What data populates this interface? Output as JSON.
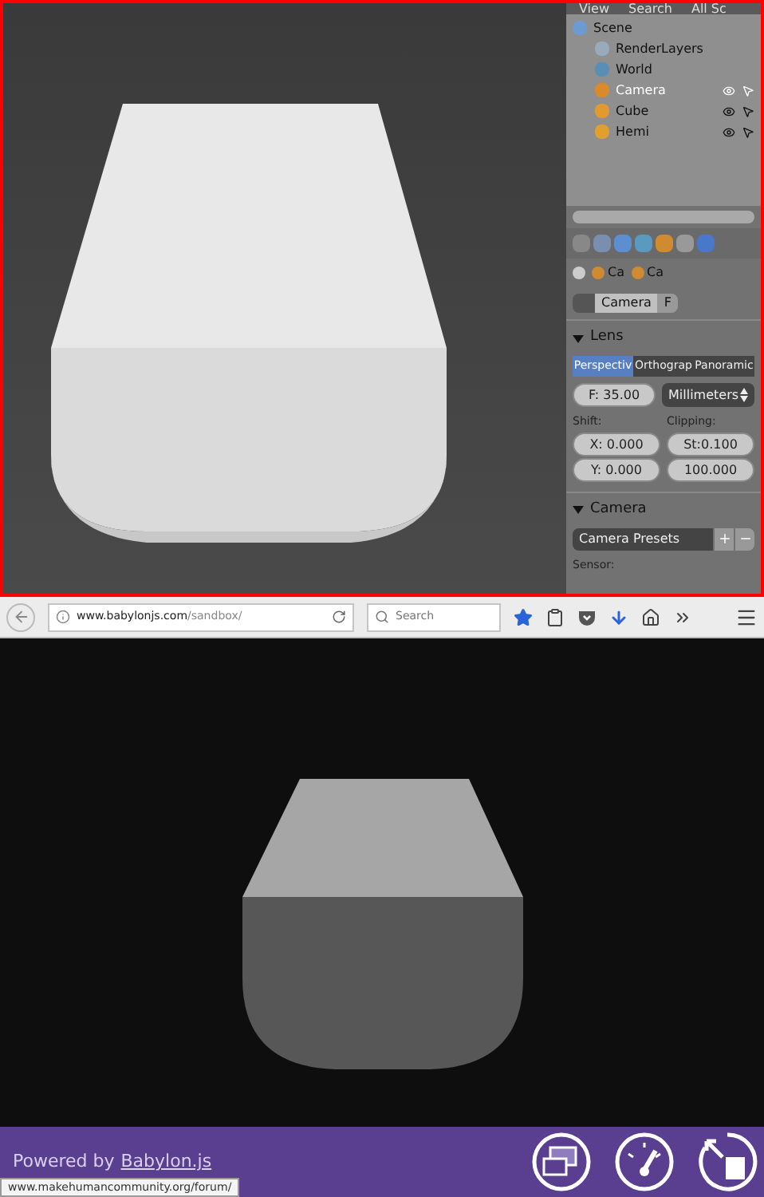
{
  "blender": {
    "outliner_header": {
      "tabs": [
        "View",
        "Search",
        "All Sc"
      ]
    },
    "outliner": [
      {
        "label": "Scene",
        "kind": "scene",
        "selected": false,
        "children": [
          {
            "label": "RenderLayers",
            "kind": "layers",
            "selected": false
          },
          {
            "label": "World",
            "kind": "world",
            "selected": false
          },
          {
            "label": "Camera",
            "kind": "camera",
            "selected": true
          },
          {
            "label": "Cube",
            "kind": "mesh",
            "selected": false
          },
          {
            "label": "Hemi",
            "kind": "lamp",
            "selected": false
          }
        ]
      }
    ],
    "breadcrumb": [
      "Ca",
      "Ca"
    ],
    "datablock": {
      "name": "Camera",
      "fake_user": "F"
    },
    "lens": {
      "title": "Lens",
      "expanded": true,
      "projection": [
        {
          "label": "Perspectiv",
          "selected": true
        },
        {
          "label": "Orthograp",
          "selected": false
        },
        {
          "label": "Panoramic",
          "selected": false
        }
      ],
      "focal": "F: 35.00",
      "unit": "Millimeters",
      "shift_label": "Shift:",
      "shift": [
        "X: 0.000",
        "Y: 0.000"
      ],
      "clipping_label": "Clipping:",
      "clipping": [
        "St:0.100",
        "100.000"
      ]
    },
    "camera": {
      "title": "Camera",
      "expanded": true,
      "presets": "Camera Presets",
      "sensor_label": "Sensor:"
    }
  },
  "browser": {
    "url_host": "www.babylonjs.com",
    "url_path": "/sandbox/",
    "search_placeholder": "Search",
    "footer": {
      "powered": "Powered by",
      "link": "Babylon.js"
    },
    "status_url": "www.makehumancommunity.org/forum/"
  }
}
